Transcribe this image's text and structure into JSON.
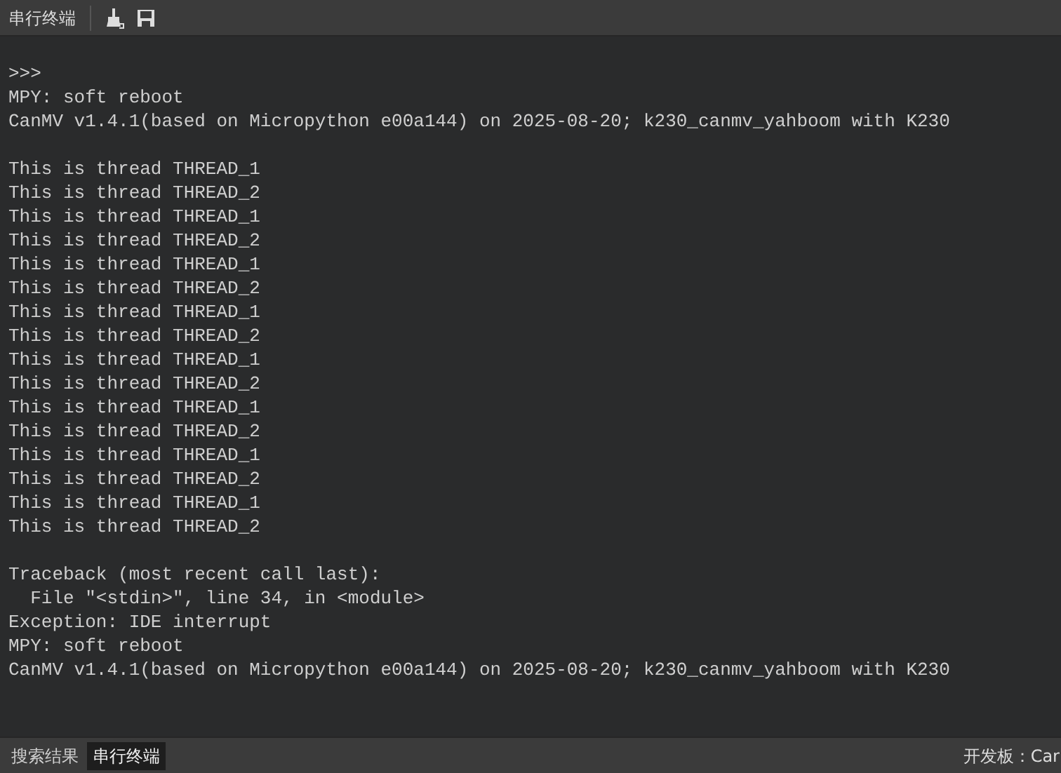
{
  "toolbar": {
    "title": "串行终端"
  },
  "terminal": {
    "blocks": [
      [
        ">>>",
        "MPY: soft reboot",
        "CanMV v1.4.1(based on Micropython e00a144) on 2025-08-20; k230_canmv_yahboom with K230"
      ],
      [
        "This is thread THREAD_1",
        "This is thread THREAD_2",
        "This is thread THREAD_1",
        "This is thread THREAD_2",
        "This is thread THREAD_1",
        "This is thread THREAD_2",
        "This is thread THREAD_1",
        "This is thread THREAD_2",
        "This is thread THREAD_1",
        "This is thread THREAD_2",
        "This is thread THREAD_1",
        "This is thread THREAD_2",
        "This is thread THREAD_1",
        "This is thread THREAD_2",
        "This is thread THREAD_1",
        "This is thread THREAD_2"
      ],
      [
        "Traceback (most recent call last):",
        "  File \"<stdin>\", line 34, in <module>",
        "Exception: IDE interrupt",
        "MPY: soft reboot",
        "CanMV v1.4.1(based on Micropython e00a144) on 2025-08-20; k230_canmv_yahboom with K230"
      ]
    ]
  },
  "bottom_tabs": [
    {
      "label": "搜索结果",
      "selected": false
    },
    {
      "label": "串行终端",
      "selected": true
    }
  ],
  "status": "开发板：Car"
}
